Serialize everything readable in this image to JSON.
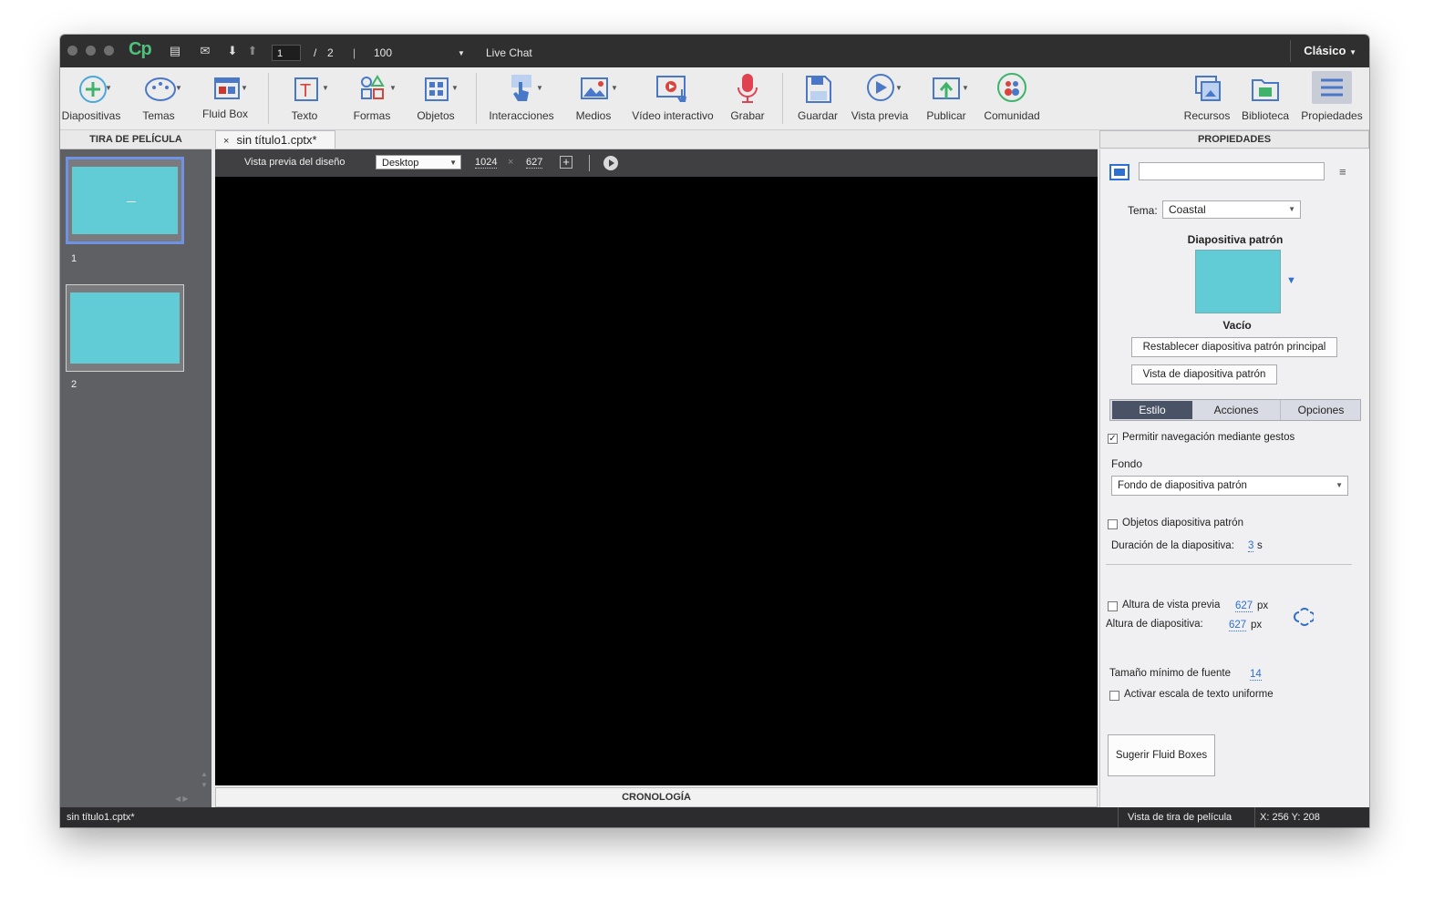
{
  "topbar": {
    "page_current": "1",
    "page_sep": "/",
    "page_total": "2",
    "zoom": "100",
    "live_chat": "Live Chat",
    "mode": "Clásico"
  },
  "toolbar": {
    "tools": [
      {
        "label": "Diapositivas",
        "icon": "add-slide-icon"
      },
      {
        "label": "Temas",
        "icon": "palette-icon"
      },
      {
        "label": "Fluid Box",
        "icon": "fluid-box-icon"
      },
      {
        "label": "Texto",
        "icon": "text-icon"
      },
      {
        "label": "Formas",
        "icon": "shapes-icon"
      },
      {
        "label": "Objetos",
        "icon": "objects-icon"
      },
      {
        "label": "Interacciones",
        "icon": "interactions-icon"
      },
      {
        "label": "Medios",
        "icon": "media-icon"
      },
      {
        "label": "Vídeo interactivo",
        "icon": "interactive-video-icon"
      },
      {
        "label": "Grabar",
        "icon": "microphone-icon"
      },
      {
        "label": "Guardar",
        "icon": "save-icon"
      },
      {
        "label": "Vista previa",
        "icon": "preview-icon"
      },
      {
        "label": "Publicar",
        "icon": "publish-icon"
      },
      {
        "label": "Comunidad",
        "icon": "community-icon"
      },
      {
        "label": "Recursos",
        "icon": "assets-icon"
      },
      {
        "label": "Biblioteca",
        "icon": "library-icon"
      },
      {
        "label": "Propiedades",
        "icon": "properties-icon"
      }
    ]
  },
  "filmstrip": {
    "title": "TIRA DE PELÍCULA",
    "slides": [
      {
        "number": "1"
      },
      {
        "number": "2"
      }
    ]
  },
  "document": {
    "tab_close": "×",
    "tab_title": "sin título1.cptx*"
  },
  "stage": {
    "preview_label": "Vista previa del diseño",
    "device": "Desktop",
    "width": "1024",
    "times": "×",
    "height": "627",
    "timeline": "CRONOLOGÍA"
  },
  "properties": {
    "title": "PROPIEDADES",
    "name_value": "",
    "theme_label": "Tema:",
    "theme_value": "Coastal",
    "master_label": "Diapositiva patrón",
    "master_name": "Vacío",
    "reset_master_btn": "Restablecer diapositiva patrón principal",
    "master_view_btn": "Vista de diapositiva patrón",
    "tabs": [
      "Estilo",
      "Acciones",
      "Opciones"
    ],
    "gestures_label": "Permitir navegación mediante gestos",
    "gestures_checked": true,
    "background_label": "Fondo",
    "background_value": "Fondo de diapositiva patrón",
    "master_objects_label": "Objetos diapositiva patrón",
    "duration_label": "Duración de la diapositiva:",
    "duration_value": "3",
    "duration_unit": "s",
    "preview_height_label": "Altura de vista previa",
    "preview_height_value": "627",
    "px1": "px",
    "slide_height_label": "Altura de diapositiva:",
    "slide_height_value": "627",
    "px2": "px",
    "min_font_label": "Tamaño mínimo de fuente",
    "min_font_value": "14",
    "uniform_scale_label": "Activar escala de texto uniforme",
    "suggest_btn": "Sugerir Fluid Boxes"
  },
  "status": {
    "filename": "sin título1.cptx*",
    "view": "Vista de tira de película",
    "coords": "X: 256 Y: 208"
  },
  "colors": {
    "slide_bg": "#62ccd6",
    "accent": "#2e6fcf",
    "logo": "#4fc07a"
  }
}
